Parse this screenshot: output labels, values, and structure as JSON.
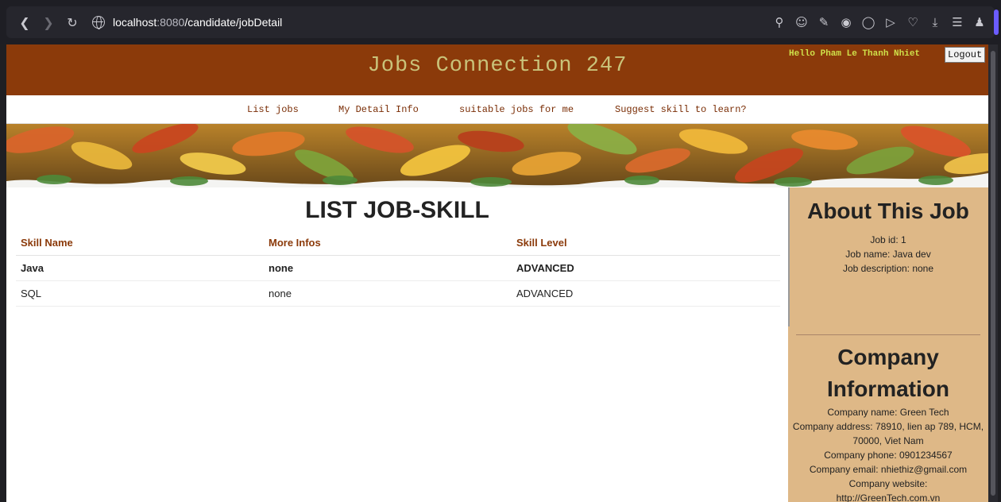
{
  "browser": {
    "url_host": "localhost",
    "url_port": ":8080",
    "url_path": "/candidate/jobDetail"
  },
  "header": {
    "site_title": "Jobs Connection 247",
    "greeting": "Hello Pham Le Thanh Nhiet",
    "logout_label": "Logout",
    "brand_color": "#8b3a0a"
  },
  "menu": {
    "items": [
      {
        "label": "List jobs"
      },
      {
        "label": "My Detail Info"
      },
      {
        "label": "suitable jobs for me"
      },
      {
        "label": "Suggest skill to learn?"
      }
    ]
  },
  "main": {
    "title": "LIST JOB-SKILL",
    "columns": [
      "Skill Name",
      "More Infos",
      "Skill Level"
    ],
    "rows": [
      {
        "skill": "Java",
        "info": "none",
        "level": "ADVANCED"
      },
      {
        "skill": "SQL",
        "info": "none",
        "level": "ADVANCED"
      }
    ]
  },
  "sidebar": {
    "about_title": "About This Job",
    "job_id": "Job id: 1",
    "job_name": "Job name: Java dev",
    "job_description": "Job description: none",
    "company_title": "Company Information",
    "company_name": "Company name: Green Tech",
    "company_address": "Company address: 78910, lien ap 789, HCM, 70000, Viet Nam",
    "company_phone": "Company phone: 0901234567",
    "company_email": "Company email: nhiethiz@gmail.com",
    "company_website_label": "Company website:",
    "company_website": "http://GreenTech.com.vn"
  }
}
